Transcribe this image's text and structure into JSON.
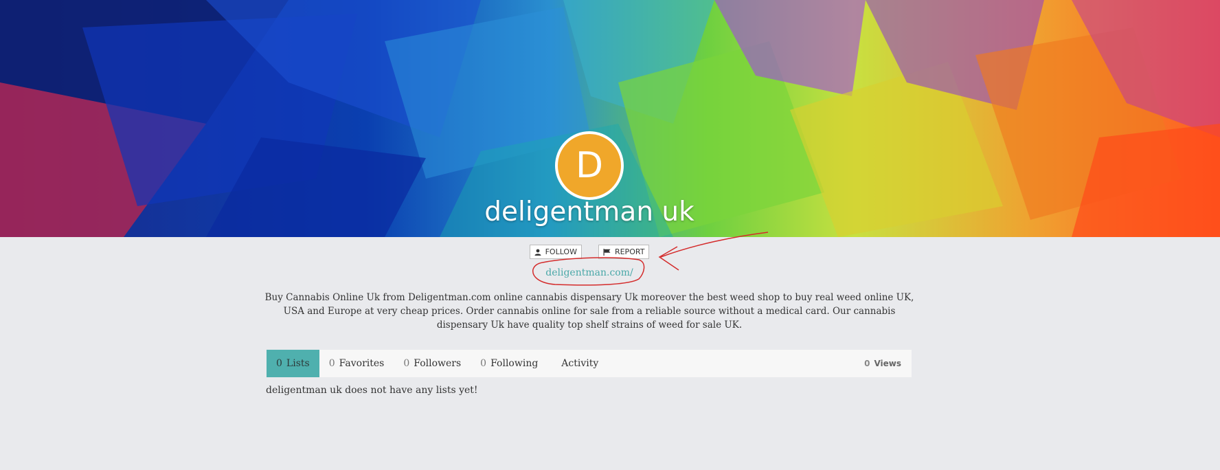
{
  "profile": {
    "avatar_letter": "D",
    "name": "deligentman uk",
    "website": "deligentman.com/",
    "bio": "Buy Cannabis Online Uk from Deligentman.com online cannabis dispensary Uk moreover the best weed shop to buy real weed online UK, USA and Europe at very cheap prices. Order cannabis online for sale from a reliable source without a medical card. Our cannabis dispensary Uk have quality top shelf strains of weed for sale UK."
  },
  "actions": {
    "follow_label": "FOLLOW",
    "report_label": "REPORT",
    "follow_icon": "user-icon",
    "report_icon": "flag-icon"
  },
  "tabs": [
    {
      "count": "0",
      "label": "Lists",
      "active": true
    },
    {
      "count": "0",
      "label": "Favorites",
      "active": false
    },
    {
      "count": "0",
      "label": "Followers",
      "active": false
    },
    {
      "count": "0",
      "label": "Following",
      "active": false
    },
    {
      "label": "Activity",
      "active": false
    }
  ],
  "views": {
    "count": "0",
    "label": "Views"
  },
  "empty_message": "deligentman uk does not have any lists yet!",
  "colors": {
    "accent": "#4fb0ae",
    "avatar_bg": "#f0a72a",
    "link": "#4aa8a8",
    "annotation": "#d42a2a"
  }
}
